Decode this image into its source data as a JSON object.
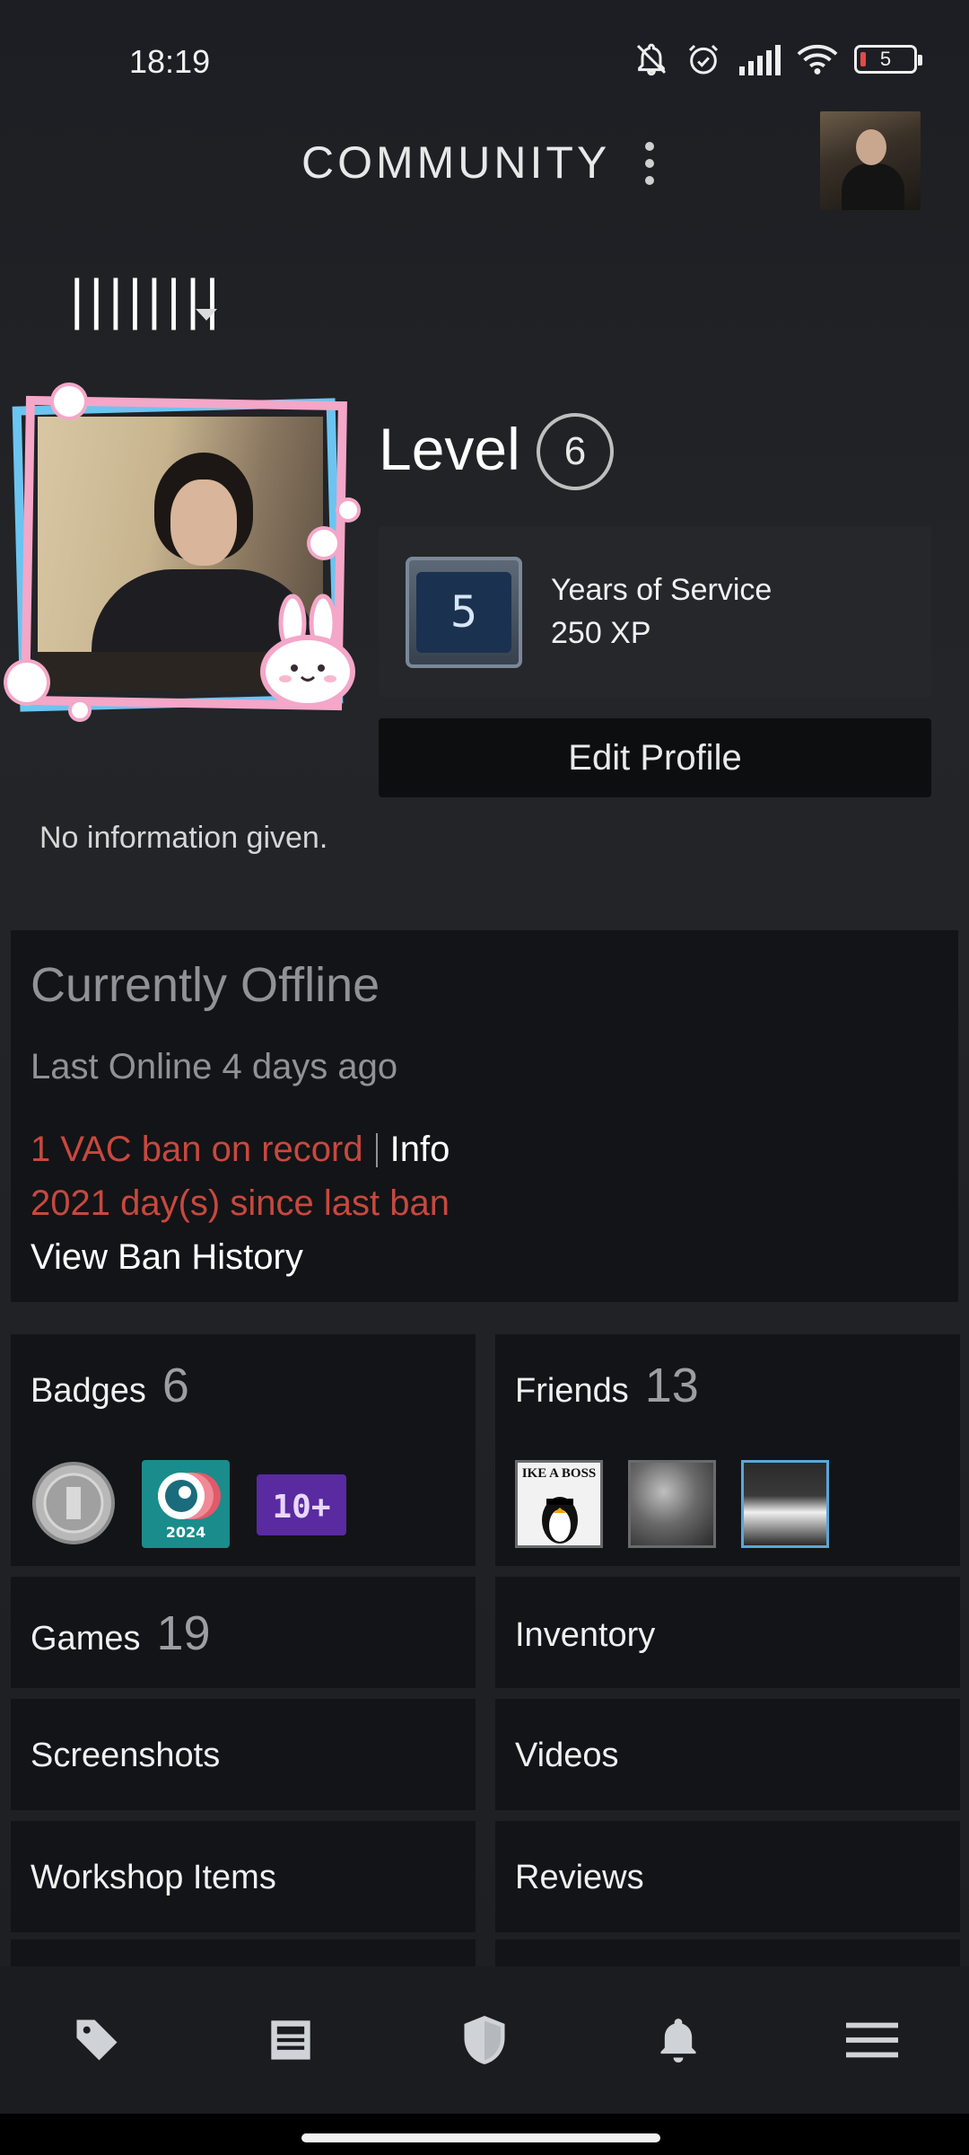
{
  "status_bar": {
    "time": "18:19",
    "battery": "5",
    "icons": [
      "bell-off-icon",
      "alarm-icon",
      "signal-icon",
      "wifi-icon",
      "battery-icon"
    ]
  },
  "header": {
    "title": "COMMUNITY"
  },
  "profile": {
    "name": "||||||||",
    "level_label": "Level",
    "level": "6",
    "badge": {
      "number": "5",
      "name": "Years of Service",
      "xp": "250 XP"
    },
    "edit_label": "Edit Profile",
    "summary": "No information given."
  },
  "status": {
    "state": "Currently Offline",
    "last_online": "Last Online 4 days ago",
    "vac": "1 VAC ban on record",
    "info_link": "Info",
    "days_since": "2021 day(s) since last ban",
    "history_link": "View Ban History"
  },
  "tiles": {
    "badges": {
      "label": "Badges",
      "count": "6",
      "badge_year": "2024",
      "badge_more": "10+"
    },
    "friends": {
      "label": "Friends",
      "count": "13",
      "friend1_text": "IKE A BOSS"
    },
    "games": {
      "label": "Games",
      "count": "19"
    },
    "inventory": {
      "label": "Inventory"
    },
    "screenshots": {
      "label": "Screenshots"
    },
    "videos": {
      "label": "Videos"
    },
    "workshop": {
      "label": "Workshop Items"
    },
    "reviews": {
      "label": "Reviews"
    }
  },
  "bottom_nav": [
    "tag-icon",
    "news-icon",
    "shield-icon",
    "bell-icon",
    "menu-icon"
  ]
}
